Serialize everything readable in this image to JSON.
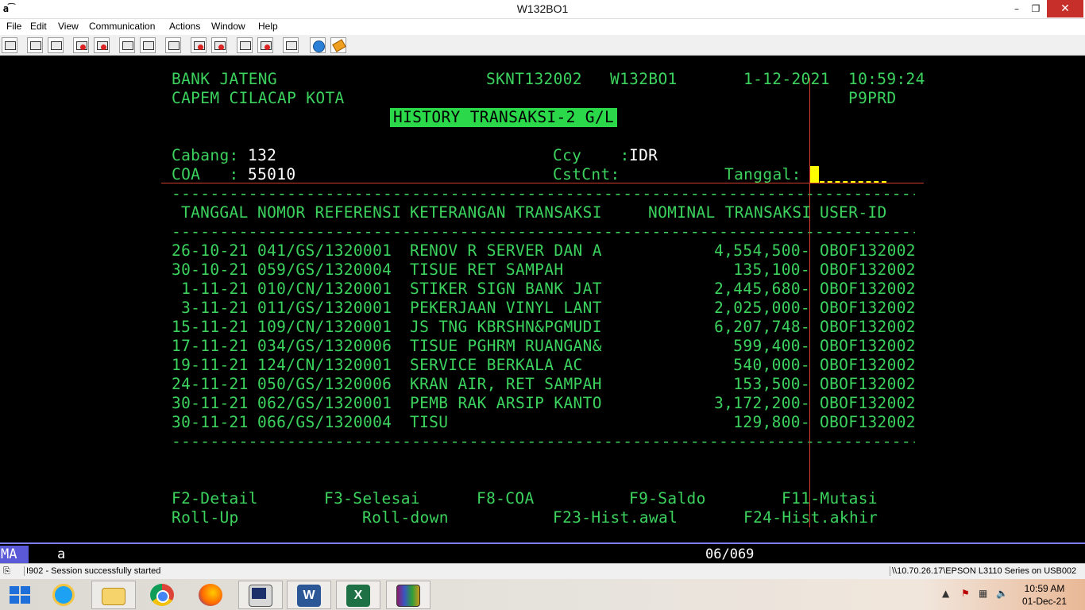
{
  "window": {
    "title": "W132BO1",
    "icon_text": "a͡",
    "minimize": "–",
    "maximize": "❐",
    "close": "✕"
  },
  "menu": [
    "File",
    "Edit",
    "View",
    "Communication",
    "Actions",
    "Window",
    "Help"
  ],
  "toolbar_icons": [
    "print-screen-icon",
    "copy-icon",
    "paste-icon",
    "send-file-icon",
    "receive-file-icon",
    "display-icon",
    "keyboard-icon",
    "macro-icon",
    "record-macro-icon",
    "play-macro-icon",
    "stop-macro-icon",
    "clipboard-icon",
    "globe-icon",
    "key-icon"
  ],
  "screen": {
    "bank": "BANK JATENG",
    "system_code": "SKNT132002",
    "terminal_id": "W132BO1",
    "date": "1-12-2021",
    "time": "10:59:24",
    "branch_name": "CAPEM CILACAP KOTA",
    "environment": "P9PRD",
    "title": "HISTORY TRANSAKSI-2 G/L",
    "cabang_label": "Cabang:",
    "cabang_value": "132",
    "ccy_label": "Ccy    :",
    "ccy_value": "IDR",
    "coa_label": "COA   :",
    "coa_value": "55010",
    "cstcnt_label": "CstCnt:",
    "tanggal_label": "Tanggal:",
    "dashes": "-----------------------------------------------------------------------------------------------------",
    "headers": {
      "tanggal": "TANGGAL",
      "referensi": "NOMOR REFERENSI",
      "keterangan": "KETERANGAN TRANSAKSI",
      "nominal": "NOMINAL TRANSAKSI",
      "user": "USER-ID"
    },
    "rows": [
      {
        "tanggal": "26-10-21",
        "ref": "041/GS/1320001",
        "ket": "RENOV R SERVER DAN A",
        "nominal": "4,554,500-",
        "user": "OBOF132002"
      },
      {
        "tanggal": "30-10-21",
        "ref": "059/GS/1320004",
        "ket": "TISUE RET SAMPAH",
        "nominal": "135,100-",
        "user": "OBOF132002"
      },
      {
        "tanggal": " 1-11-21",
        "ref": "010/CN/1320001",
        "ket": "STIKER SIGN BANK JAT",
        "nominal": "2,445,680-",
        "user": "OBOF132002"
      },
      {
        "tanggal": " 3-11-21",
        "ref": "011/GS/1320001",
        "ket": "PEKERJAAN VINYL LANT",
        "nominal": "2,025,000-",
        "user": "OBOF132002"
      },
      {
        "tanggal": "15-11-21",
        "ref": "109/CN/1320001",
        "ket": "JS TNG KBRSHN&PGMUDI",
        "nominal": "6,207,748-",
        "user": "OBOF132002"
      },
      {
        "tanggal": "17-11-21",
        "ref": "034/GS/1320006",
        "ket": "TISUE PGHRM RUANGAN&",
        "nominal": "599,400-",
        "user": "OBOF132002"
      },
      {
        "tanggal": "19-11-21",
        "ref": "124/CN/1320001",
        "ket": "SERVICE BERKALA AC",
        "nominal": "540,000-",
        "user": "OBOF132002"
      },
      {
        "tanggal": "24-11-21",
        "ref": "050/GS/1320006",
        "ket": "KRAN AIR, RET SAMPAH",
        "nominal": "153,500-",
        "user": "OBOF132002"
      },
      {
        "tanggal": "30-11-21",
        "ref": "062/GS/1320001",
        "ket": "PEMB RAK ARSIP KANTO",
        "nominal": "3,172,200-",
        "user": "OBOF132002"
      },
      {
        "tanggal": "30-11-21",
        "ref": "066/GS/1320004",
        "ket": "TISU",
        "nominal": "129,800-",
        "user": "OBOF132002"
      }
    ],
    "fkeys": {
      "f2": "F2-Detail",
      "f3": "F3-Selesai",
      "f8": "F8-COA",
      "f9": "F9-Saldo",
      "f11": "F11-Mutasi",
      "rollup": "Roll-Up",
      "rolldown": "Roll-down",
      "f23": "F23-Hist.awal",
      "f24": "F24-Hist.akhir"
    }
  },
  "oia": {
    "session": "MA",
    "mode": "a",
    "cursor_pos": "06/069"
  },
  "statusbar": {
    "message": "I902 - Session successfully started",
    "printer": "\\\\10.70.26.17\\EPSON L3110 Series on USB002"
  },
  "taskbar": {
    "apps": [
      "start-icon",
      "internet-explorer-icon",
      "file-explorer-icon",
      "chrome-icon",
      "firefox-icon",
      "terminal-emulator-icon",
      "word-icon",
      "excel-icon",
      "winrar-icon"
    ],
    "word_letter": "W",
    "excel_letter": "X",
    "tray": {
      "arrow": "▲",
      "flag": "⚑",
      "network": "▦",
      "volume": "🔈"
    },
    "time": "10:59 AM",
    "date": "01-Dec-21"
  },
  "colors": {
    "terminal_green": "#3cd25e",
    "terminal_bg": "#000000",
    "title_highlight": "#2bd84a",
    "cursor": "#ffff00",
    "crosshair": "#d23a2a"
  }
}
